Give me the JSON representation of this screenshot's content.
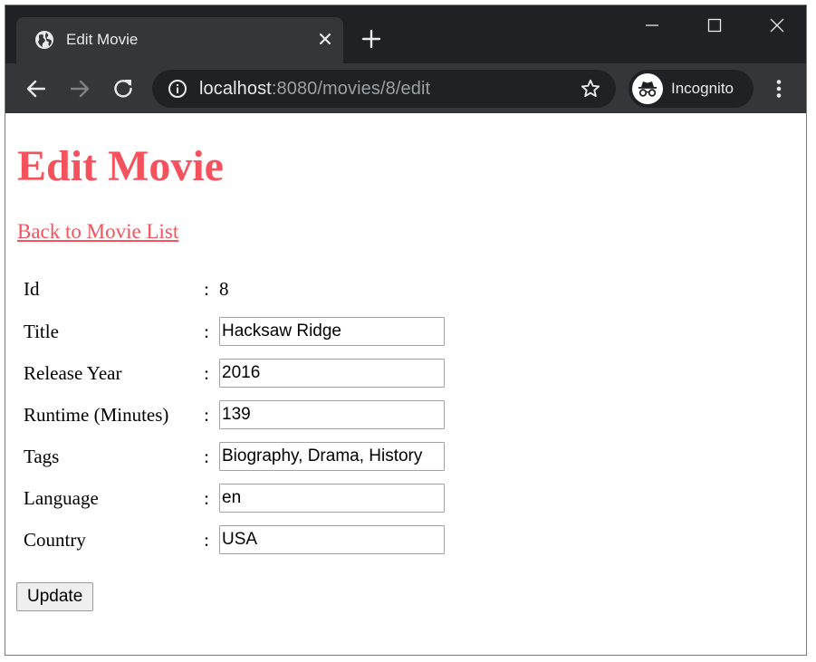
{
  "browser": {
    "tab": {
      "title": "Edit Movie",
      "favicon": "globe-icon"
    },
    "address": {
      "host": "localhost",
      "rest": ":8080/movies/8/edit"
    },
    "profile_label": "Incognito"
  },
  "page": {
    "title": "Edit Movie",
    "back_link": "Back to Movie List",
    "separator": ":",
    "id_label": "Id",
    "id_value": "8",
    "fields": [
      {
        "label": "Title",
        "value": "Hacksaw Ridge"
      },
      {
        "label": "Release Year",
        "value": "2016"
      },
      {
        "label": "Runtime (Minutes)",
        "value": "139"
      },
      {
        "label": "Tags",
        "value": "Biography, Drama, History"
      },
      {
        "label": "Language",
        "value": "en"
      },
      {
        "label": "Country",
        "value": "USA"
      }
    ],
    "submit_label": "Update"
  },
  "colors": {
    "accent": "#f5525d",
    "tabstrip": "#202124",
    "toolbar": "#35363a",
    "omnibox": "#202124"
  }
}
